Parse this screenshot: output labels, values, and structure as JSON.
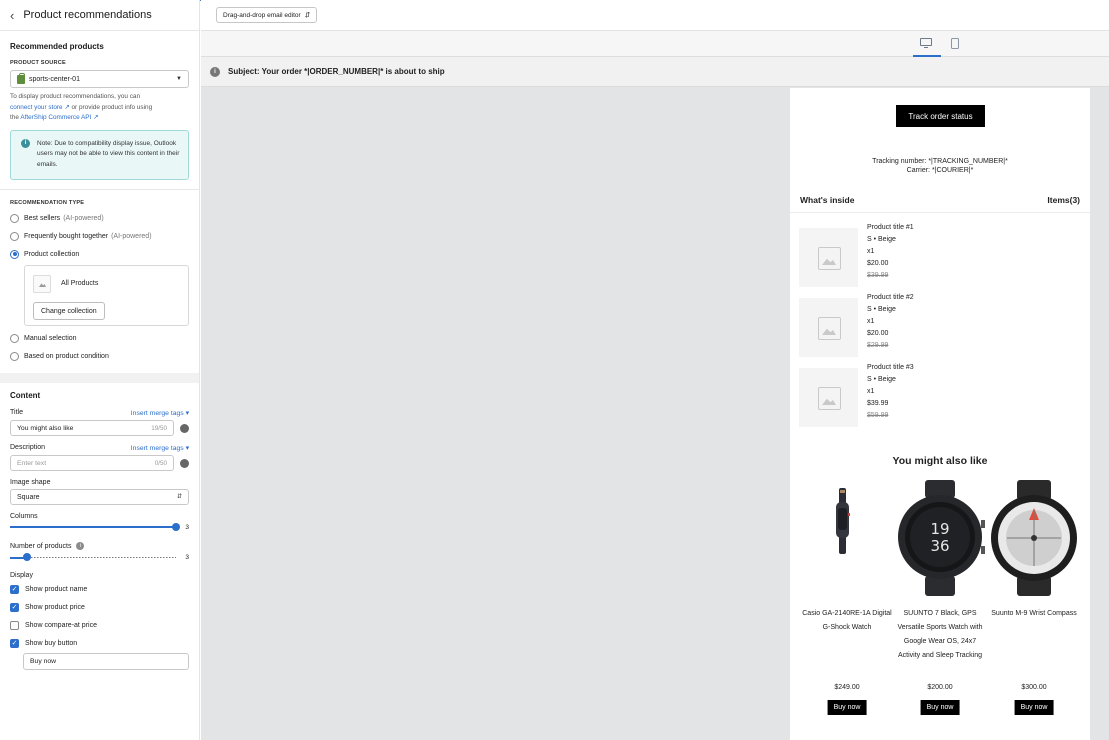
{
  "sidebar": {
    "header_title": "Product recommendations",
    "recommended_heading": "Recommended products",
    "product_source_label": "PRODUCT SOURCE",
    "product_source_value": "sports-center-01",
    "help_text_1": "To display product recommendations, you can",
    "help_link_1": "connect your store",
    "help_text_2": " or provide product info using",
    "help_text_3": "the ",
    "help_link_2": "AfterShip Commerce API",
    "note_text": "Note: Due to compatibility display issue, Outlook users may not be able to view this content in their emails.",
    "rec_type_label": "RECOMMENDATION TYPE",
    "rec_types": [
      {
        "label": "Best sellers",
        "sub": "(AI-powered)",
        "selected": false
      },
      {
        "label": "Frequently bought together",
        "sub": "(AI-powered)",
        "selected": false
      },
      {
        "label": "Product collection",
        "sub": "",
        "selected": true
      },
      {
        "label": "Manual selection",
        "sub": "",
        "selected": false
      },
      {
        "label": "Based on product condition",
        "sub": "",
        "selected": false
      }
    ],
    "collection_name": "All Products",
    "change_collection_label": "Change collection",
    "content_heading": "Content",
    "title_label": "Title",
    "insert_merge_tags": "Insert merge tags",
    "title_value": "You might also like",
    "title_count": "19/50",
    "description_label": "Description",
    "description_placeholder": "Enter text",
    "description_count": "0/50",
    "image_shape_label": "Image shape",
    "image_shape_value": "Square",
    "columns_label": "Columns",
    "columns_value": "3",
    "columns_fraction": 1.0,
    "num_products_label": "Number of products",
    "num_products_value": "3",
    "num_products_fraction": 0.1,
    "display_label": "Display",
    "display_options": [
      {
        "label": "Show product name",
        "checked": true
      },
      {
        "label": "Show product price",
        "checked": true
      },
      {
        "label": "Show compare-at price",
        "checked": false
      },
      {
        "label": "Show buy button",
        "checked": true
      }
    ],
    "buy_button_text": "Buy now"
  },
  "toolbar": {
    "editor_mode": "Drag-and-drop email editor"
  },
  "preview": {
    "subject": "Subject: Your order *|ORDER_NUMBER|* is about to ship",
    "track_button": "Track order status",
    "tracking_number": "Tracking number: *|TRACKING_NUMBER|*",
    "carrier": "Carrier: *|COURIER|*",
    "whats_inside": "What's inside",
    "items_count": "Items(3)",
    "items": [
      {
        "title": "Product title #1",
        "variant": "S • Beige",
        "qty": "x1",
        "price": "$20.00",
        "compare": "$39.99"
      },
      {
        "title": "Product title #2",
        "variant": "S • Beige",
        "qty": "x1",
        "price": "$20.00",
        "compare": "$29.99"
      },
      {
        "title": "Product title #3",
        "variant": "S • Beige",
        "qty": "x1",
        "price": "$39.99",
        "compare": "$59.99"
      }
    ],
    "recommend_title": "You might also like",
    "products": [
      {
        "name": "Casio GA-2140RE-1A Digital G-Shock Watch",
        "price": "$249.00",
        "buy": "Buy now"
      },
      {
        "name": "SUUNTO 7 Black, GPS Versatile Sports Watch with Google Wear OS, 24x7 Activity and Sleep Tracking",
        "price": "$200.00",
        "buy": "Buy now"
      },
      {
        "name": "Suunto M-9 Wrist Compass",
        "price": "$300.00",
        "buy": "Buy now"
      }
    ],
    "watch_face_text": "19\n36"
  }
}
